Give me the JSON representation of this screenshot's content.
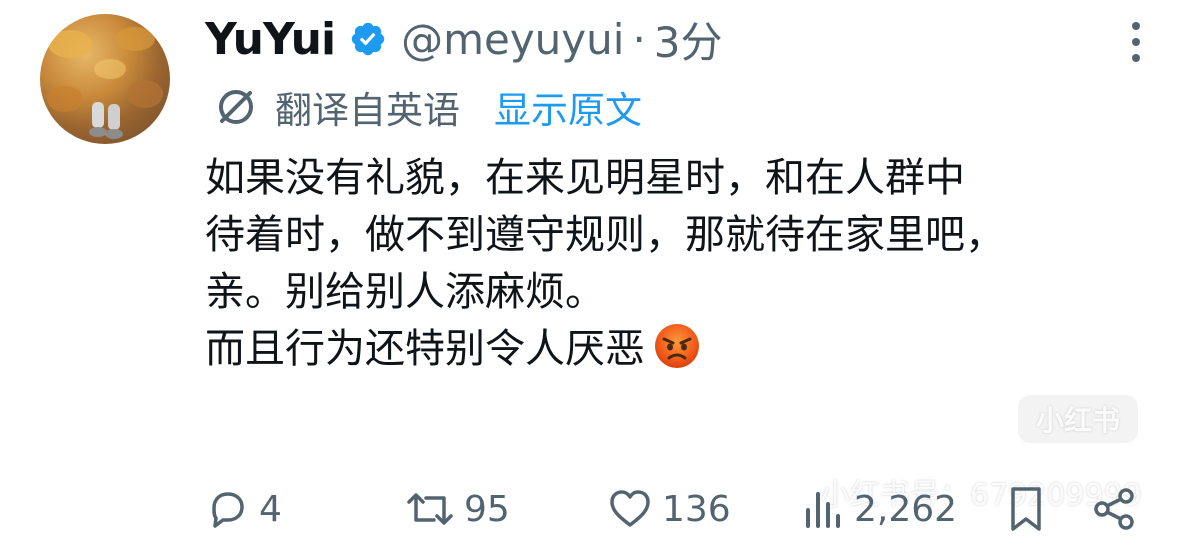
{
  "tweet": {
    "display_name": "YuYui",
    "handle": "@meyuyui",
    "separator": "·",
    "time": "3分",
    "translated_label": "翻译自英语",
    "show_original": "显示原文",
    "body_lines": [
      "如果没有礼貌，在来见明星时，和在人群中",
      "待着时，做不到遵守规则，那就待在家里吧，",
      "亲。别给别人添麻烦。",
      "而且行为还特别令人厌恶"
    ],
    "emoji": "angry-face-icon"
  },
  "actions": {
    "replies": "4",
    "retweets": "95",
    "likes": "136",
    "views": "2,262"
  },
  "watermark": {
    "badge": "小红书",
    "text": "小红书号：679209999"
  },
  "colors": {
    "primary_text": "#0f1419",
    "secondary_text": "#536471",
    "link": "#1d9bf0",
    "verified": "#1d9bf0"
  }
}
